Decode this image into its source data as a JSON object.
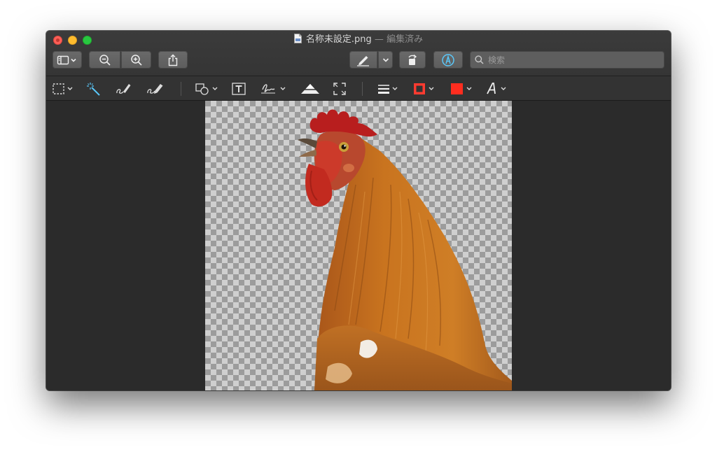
{
  "window": {
    "title": "名称未設定.png",
    "title_separator": " — ",
    "title_status": "編集済み"
  },
  "toolbar": {
    "buttons": [
      {
        "name": "sidebar-toggle",
        "icon": "sidebar-icon"
      },
      {
        "name": "zoom-out",
        "icon": "zoom-out-icon"
      },
      {
        "name": "zoom-in",
        "icon": "zoom-in-icon"
      },
      {
        "name": "share",
        "icon": "share-icon"
      },
      {
        "name": "markup-pen",
        "icon": "pen-icon"
      },
      {
        "name": "rotate",
        "icon": "rotate-icon"
      },
      {
        "name": "markup-toggle",
        "icon": "markup-icon"
      }
    ],
    "search": {
      "placeholder": "検索",
      "value": ""
    }
  },
  "markup_toolbar": {
    "tools": [
      "rectangular-selection",
      "instant-alpha",
      "sketch",
      "draw",
      "shapes",
      "text",
      "sign",
      "adjust-color",
      "adjust-size",
      "shape-style",
      "border-color",
      "fill-color",
      "text-style"
    ],
    "colors": {
      "border": "#ff3b30",
      "fill": "#ff2d1f",
      "accent": "#5ac8fa"
    }
  },
  "document": {
    "image": "rooster-cutout",
    "background": "transparency-checkerboard"
  }
}
